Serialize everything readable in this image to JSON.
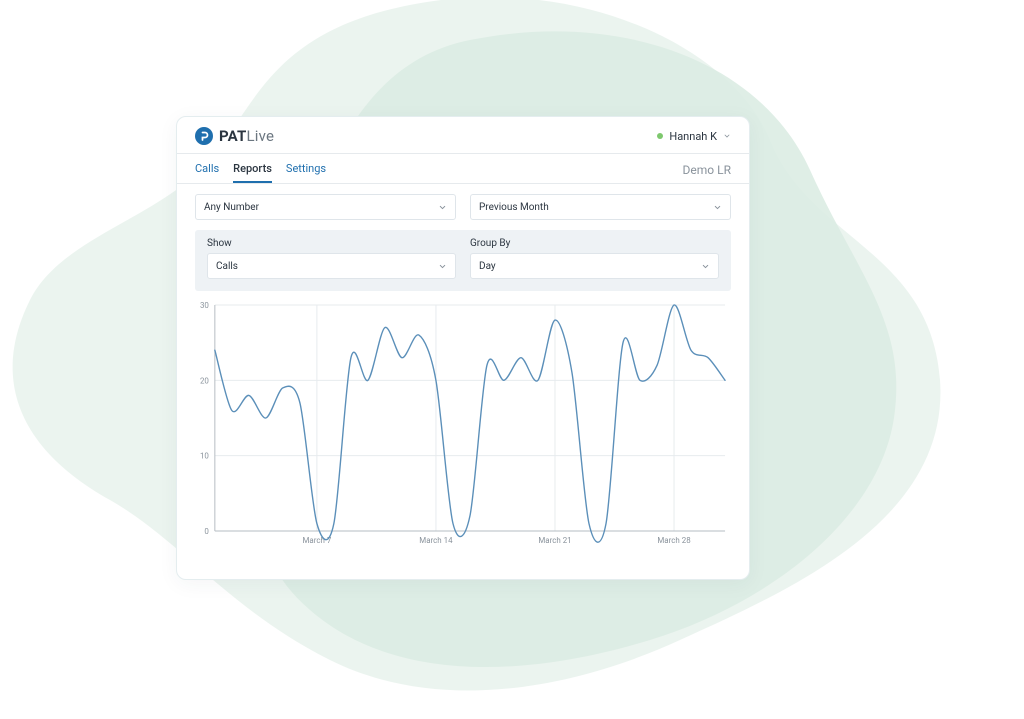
{
  "brand": {
    "bold": "PAT",
    "light": "Live"
  },
  "user": {
    "name": "Hannah K"
  },
  "account_label": "Demo LR",
  "tabs": [
    {
      "label": "Calls",
      "active": false
    },
    {
      "label": "Reports",
      "active": true
    },
    {
      "label": "Settings",
      "active": false
    }
  ],
  "filters": {
    "number": {
      "value": "Any Number"
    },
    "dateRange": {
      "value": "Previous Month"
    }
  },
  "panel": {
    "show": {
      "label": "Show",
      "value": "Calls"
    },
    "groupBy": {
      "label": "Group By",
      "value": "Day"
    }
  },
  "chart_data": {
    "type": "line",
    "title": "",
    "xlabel": "",
    "ylabel": "",
    "ylim": [
      0,
      30
    ],
    "y_ticks": [
      0,
      10,
      20,
      30
    ],
    "x_tick_labels": [
      "March 7",
      "March 14",
      "March 21",
      "March 28"
    ],
    "x_tick_indices": [
      6,
      13,
      20,
      27
    ],
    "series": [
      {
        "name": "Calls",
        "values": [
          24,
          16,
          18,
          15,
          19,
          17,
          1,
          1,
          23,
          20,
          27,
          23,
          26,
          20,
          1,
          2,
          22,
          20,
          23,
          20,
          28,
          21,
          1,
          1,
          25,
          20,
          22,
          30,
          24,
          23,
          20
        ]
      }
    ]
  },
  "colors": {
    "accent": "#1f6fae",
    "chart_line": "#5b8fb9",
    "chart_grid": "#e7ebee",
    "chart_axis": "#b6bdc3"
  }
}
